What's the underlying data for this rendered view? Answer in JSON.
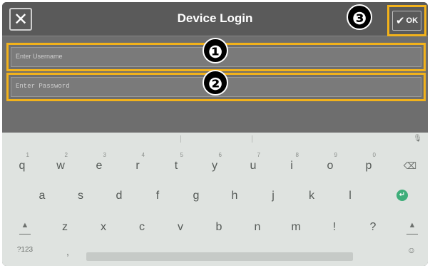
{
  "titlebar": {
    "close_glyph": "✕",
    "title": "Device Login",
    "ok_check": "✔",
    "ok_label": "OK"
  },
  "form": {
    "username_placeholder": "Enter Username",
    "password_placeholder": "Enter Password"
  },
  "badges": [
    "❶",
    "❷",
    "❸"
  ],
  "keyboard": {
    "mic": "🎙",
    "row1": [
      {
        "key": "q",
        "hint": "1"
      },
      {
        "key": "w",
        "hint": "2"
      },
      {
        "key": "e",
        "hint": "3"
      },
      {
        "key": "r",
        "hint": "4"
      },
      {
        "key": "t",
        "hint": "5"
      },
      {
        "key": "y",
        "hint": "6"
      },
      {
        "key": "u",
        "hint": "7"
      },
      {
        "key": "i",
        "hint": "8"
      },
      {
        "key": "o",
        "hint": "9"
      },
      {
        "key": "p",
        "hint": "0"
      }
    ],
    "backspace": "⌫",
    "row2": [
      "a",
      "s",
      "d",
      "f",
      "g",
      "h",
      "j",
      "k",
      "l"
    ],
    "enter": "↵",
    "row3": [
      "z",
      "x",
      "c",
      "v",
      "b",
      "n",
      "m",
      "!",
      "?"
    ],
    "shift": "▲",
    "symbols": "?123",
    "comma": ",",
    "emoji": "☺",
    "colors": {
      "accent": "#f2b21b",
      "enter": "#3fae7a"
    }
  }
}
